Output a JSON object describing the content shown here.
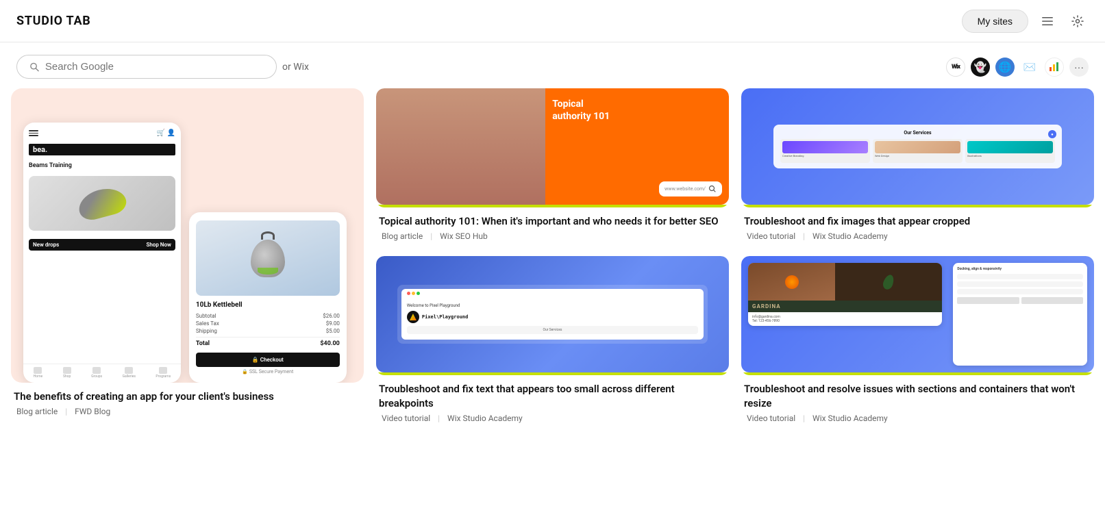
{
  "header": {
    "logo": "STUDIO TAB",
    "mySitesLabel": "My sites",
    "icons": {
      "menu": "☰",
      "settings": "⚙"
    }
  },
  "search": {
    "placeholder": "Search Google",
    "orWix": "or Wix"
  },
  "extensions": [
    {
      "id": "wix",
      "label": "Wix",
      "type": "wix"
    },
    {
      "id": "phantom",
      "label": "👻",
      "type": "phantom"
    },
    {
      "id": "earth",
      "label": "🌐",
      "type": "earth"
    },
    {
      "id": "gmail",
      "label": "✉",
      "type": "gmail"
    },
    {
      "id": "analytics",
      "label": "📊",
      "type": "analytics"
    },
    {
      "id": "more",
      "label": "•••",
      "type": "more"
    }
  ],
  "featured_card": {
    "title": "The benefits of creating an app for your client's business",
    "type": "Blog article",
    "source": "FWD Blog",
    "phone_brand": "bea.",
    "phone_product": "Beams Training",
    "phone_cta_left": "New drops",
    "phone_cta_right": "Shop Now",
    "phone_nav": [
      "Home",
      "Shop",
      "Groups",
      "Galleries",
      "Programs"
    ],
    "cart_product": "10Lb Kettlebell",
    "cart_subtotal_label": "Subtotal",
    "cart_subtotal_value": "$26.00",
    "cart_tax_label": "Sales Tax",
    "cart_tax_value": "$9.00",
    "cart_shipping_label": "Shipping",
    "cart_shipping_value": "$5.00",
    "cart_total_label": "Total",
    "cart_total_value": "$40.00",
    "cart_checkout": "🔒 Checkout",
    "cart_ssl": "🔒 SSL Secure Payment"
  },
  "articles": [
    {
      "id": "topical-authority",
      "thumb_type": "orange_person",
      "thumb_title": "Topical authority 101",
      "thumb_url": "www.website.com/",
      "title": "Topical authority 101: When it's important and who needs it for better SEO",
      "type": "Blog article",
      "source": "Wix SEO Hub"
    },
    {
      "id": "cropped-images",
      "thumb_type": "blue_services",
      "title": "Troubleshoot and fix images that appear cropped",
      "type": "Video tutorial",
      "source": "Wix Studio Academy",
      "services": {
        "title": "Our Services",
        "items": [
          {
            "label": "Creative Branding",
            "color": "purple"
          },
          {
            "label": "Web Design",
            "color": "skin"
          },
          {
            "label": "Illustrations",
            "color": "teal"
          }
        ]
      }
    },
    {
      "id": "text-breakpoints",
      "thumb_type": "pixel_playground",
      "title": "Troubleshoot and fix text that appears too small across different breakpoints",
      "type": "Video tutorial",
      "source": "Wix Studio Academy",
      "welcome_text": "Welcome to Pixel Playground",
      "services_text": "Our Services"
    },
    {
      "id": "sections-resize",
      "thumb_type": "gardina",
      "title": "Troubleshoot and resolve issues with sections and containers that won't resize",
      "type": "Video tutorial",
      "source": "Wix Studio Academy",
      "brand": "GARDINA",
      "contact": "info@gardina.com\nTel: 123-456-7890"
    }
  ],
  "colors": {
    "accent_yellow": "#c5e000",
    "brand_blue": "#4a6ef5",
    "orange": "#ff6b00",
    "dark": "#111111"
  }
}
